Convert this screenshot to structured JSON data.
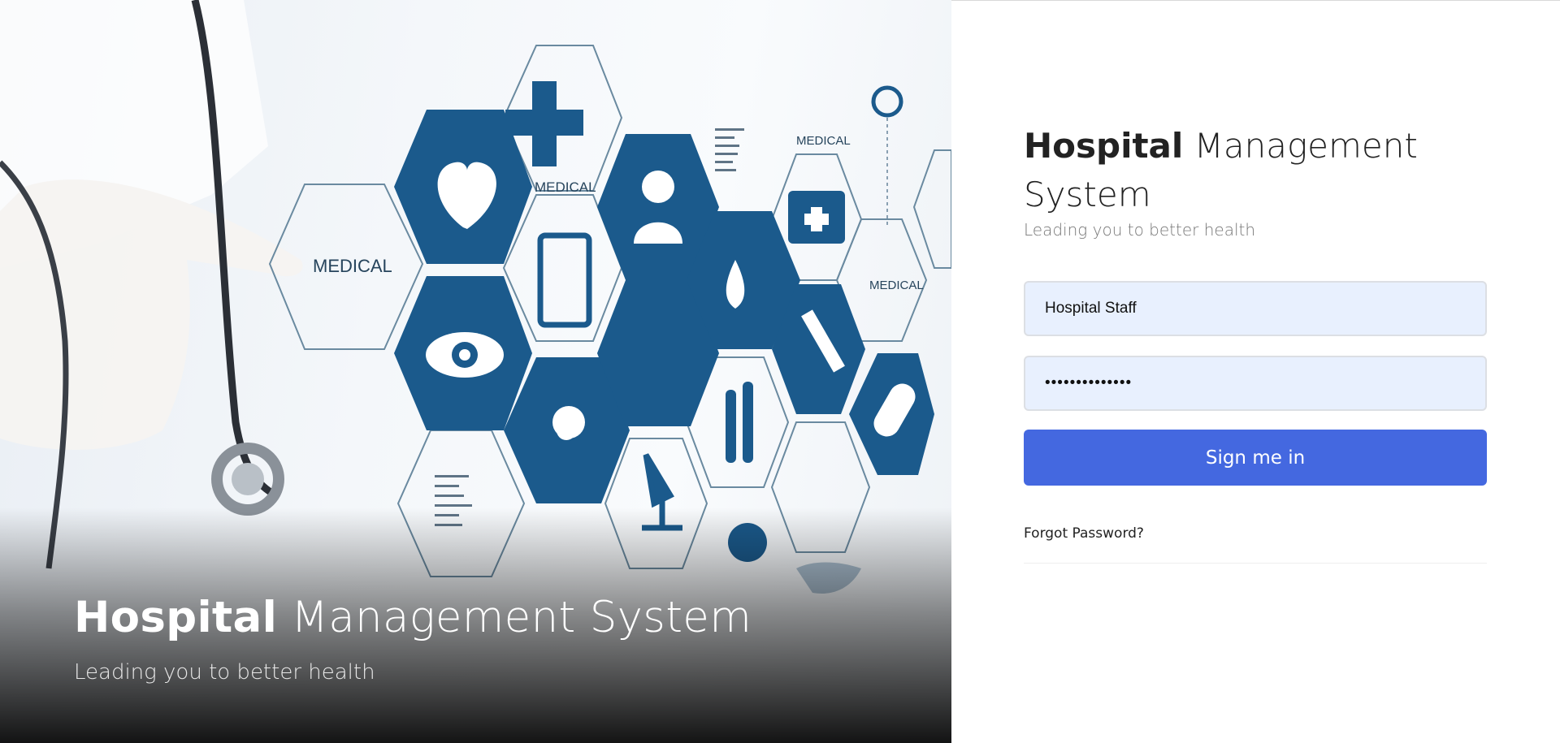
{
  "hero": {
    "title_bold": "Hospital",
    "title_rest": "Management System",
    "subtitle": "Leading you to better health",
    "hex_labels": {
      "medical_1": "MEDICAL",
      "medical_2": "MEDICAL",
      "medical_3": "MEDICAL",
      "medical_4": "MEDICAL"
    }
  },
  "login": {
    "title_bold": "Hospital",
    "title_rest": "Management System",
    "subtitle": "Leading you to better health",
    "username_value": "Hospital Staff",
    "password_value": "••••••••••••••",
    "sign_in_label": "Sign me in",
    "forgot_label": "Forgot Password?"
  },
  "colors": {
    "accent": "#4468e0",
    "hex_blue": "#1b5a8c",
    "field_bg": "#e8f0fe"
  },
  "icons": [
    "heart-icon",
    "cross-icon",
    "clipboard-icon",
    "person-icon",
    "drops-icon",
    "medical-bag-icon",
    "eye-icon",
    "wheelchair-icon",
    "dropper-icon",
    "pill-icon",
    "molecule-icon",
    "test-tubes-icon",
    "microscope-icon",
    "virus-icon",
    "world-map-icon"
  ]
}
